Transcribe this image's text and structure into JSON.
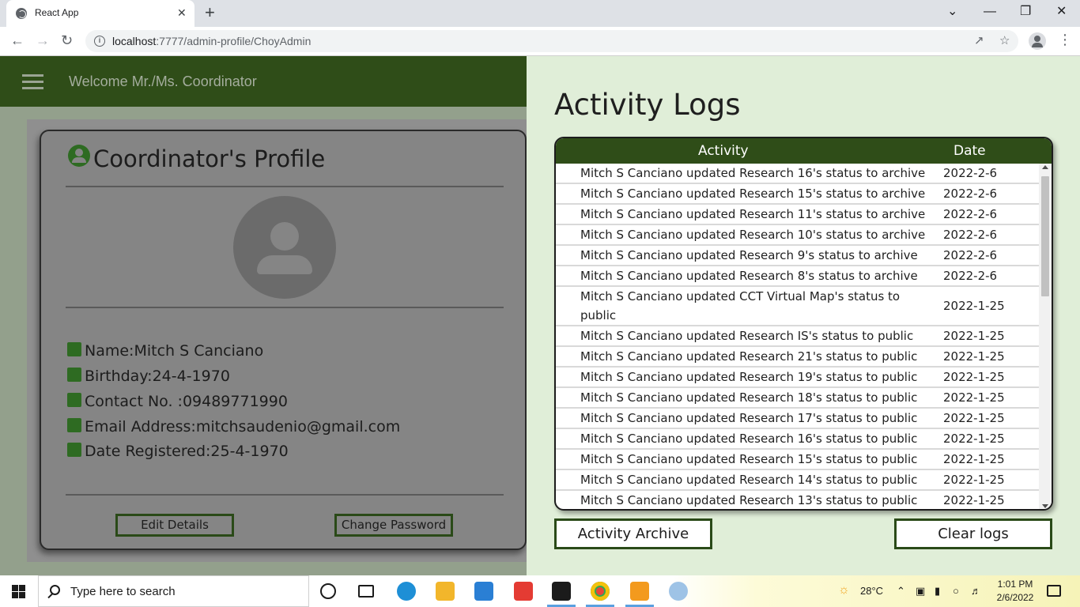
{
  "browser": {
    "tab_title": "React App",
    "tab_close": "✕",
    "new_tab": "+",
    "url_host": "localhost",
    "url_path": ":7777/admin-profile/ChoyAdmin"
  },
  "header": {
    "welcome": "Welcome Mr./Ms. Coordinator"
  },
  "profile": {
    "title": "Coordinator's Profile",
    "fields": [
      {
        "icon": "id-badge-icon",
        "text": "Name:Mitch S Canciano"
      },
      {
        "icon": "birthday-cake-icon",
        "text": "Birthday:24-4-1970"
      },
      {
        "icon": "contact-card-icon",
        "text": "Contact No. :09489771990"
      },
      {
        "icon": "email-card-icon",
        "text": "Email Address:mitchsaudenio@gmail.com"
      },
      {
        "icon": "calendar-icon",
        "text": "Date Registered:25-4-1970"
      }
    ],
    "edit_button": "Edit Details",
    "change_password_button": "Change Password"
  },
  "logs": {
    "title": "Activity Logs",
    "columns": {
      "activity": "Activity",
      "date": "Date"
    },
    "rows": [
      {
        "activity": "Mitch S Canciano updated Research 16's status to archive",
        "date": "2022-2-6"
      },
      {
        "activity": "Mitch S Canciano updated Research 15's status to archive",
        "date": "2022-2-6"
      },
      {
        "activity": "Mitch S Canciano updated Research 11's status to archive",
        "date": "2022-2-6"
      },
      {
        "activity": "Mitch S Canciano updated Research 10's status to archive",
        "date": "2022-2-6"
      },
      {
        "activity": "Mitch S Canciano updated Research 9's status to archive",
        "date": "2022-2-6"
      },
      {
        "activity": "Mitch S Canciano updated Research 8's status to archive",
        "date": "2022-2-6"
      },
      {
        "activity": "Mitch S Canciano updated CCT Virtual Map's status to public",
        "date": "2022-1-25"
      },
      {
        "activity": "Mitch S Canciano updated Research IS's status to public",
        "date": "2022-1-25"
      },
      {
        "activity": "Mitch S Canciano updated Research 21's status to public",
        "date": "2022-1-25"
      },
      {
        "activity": "Mitch S Canciano updated Research 19's status to public",
        "date": "2022-1-25"
      },
      {
        "activity": "Mitch S Canciano updated Research 18's status to public",
        "date": "2022-1-25"
      },
      {
        "activity": "Mitch S Canciano updated Research 17's status to public",
        "date": "2022-1-25"
      },
      {
        "activity": "Mitch S Canciano updated Research 16's status to public",
        "date": "2022-1-25"
      },
      {
        "activity": "Mitch S Canciano updated Research 15's status to public",
        "date": "2022-1-25"
      },
      {
        "activity": "Mitch S Canciano updated Research 14's status to public",
        "date": "2022-1-25"
      },
      {
        "activity": "Mitch S Canciano updated Research 13's status to public",
        "date": "2022-1-25"
      }
    ],
    "archive_button": "Activity Archive",
    "clear_button": "Clear logs"
  },
  "taskbar": {
    "search_placeholder": "Type here to search",
    "weather": "28°C",
    "time": "1:01 PM",
    "date": "2/6/2022"
  },
  "colors": {
    "header_green": "#2f4d18",
    "accent_green": "#2e6b22",
    "logs_bg": "#e0eed8"
  }
}
